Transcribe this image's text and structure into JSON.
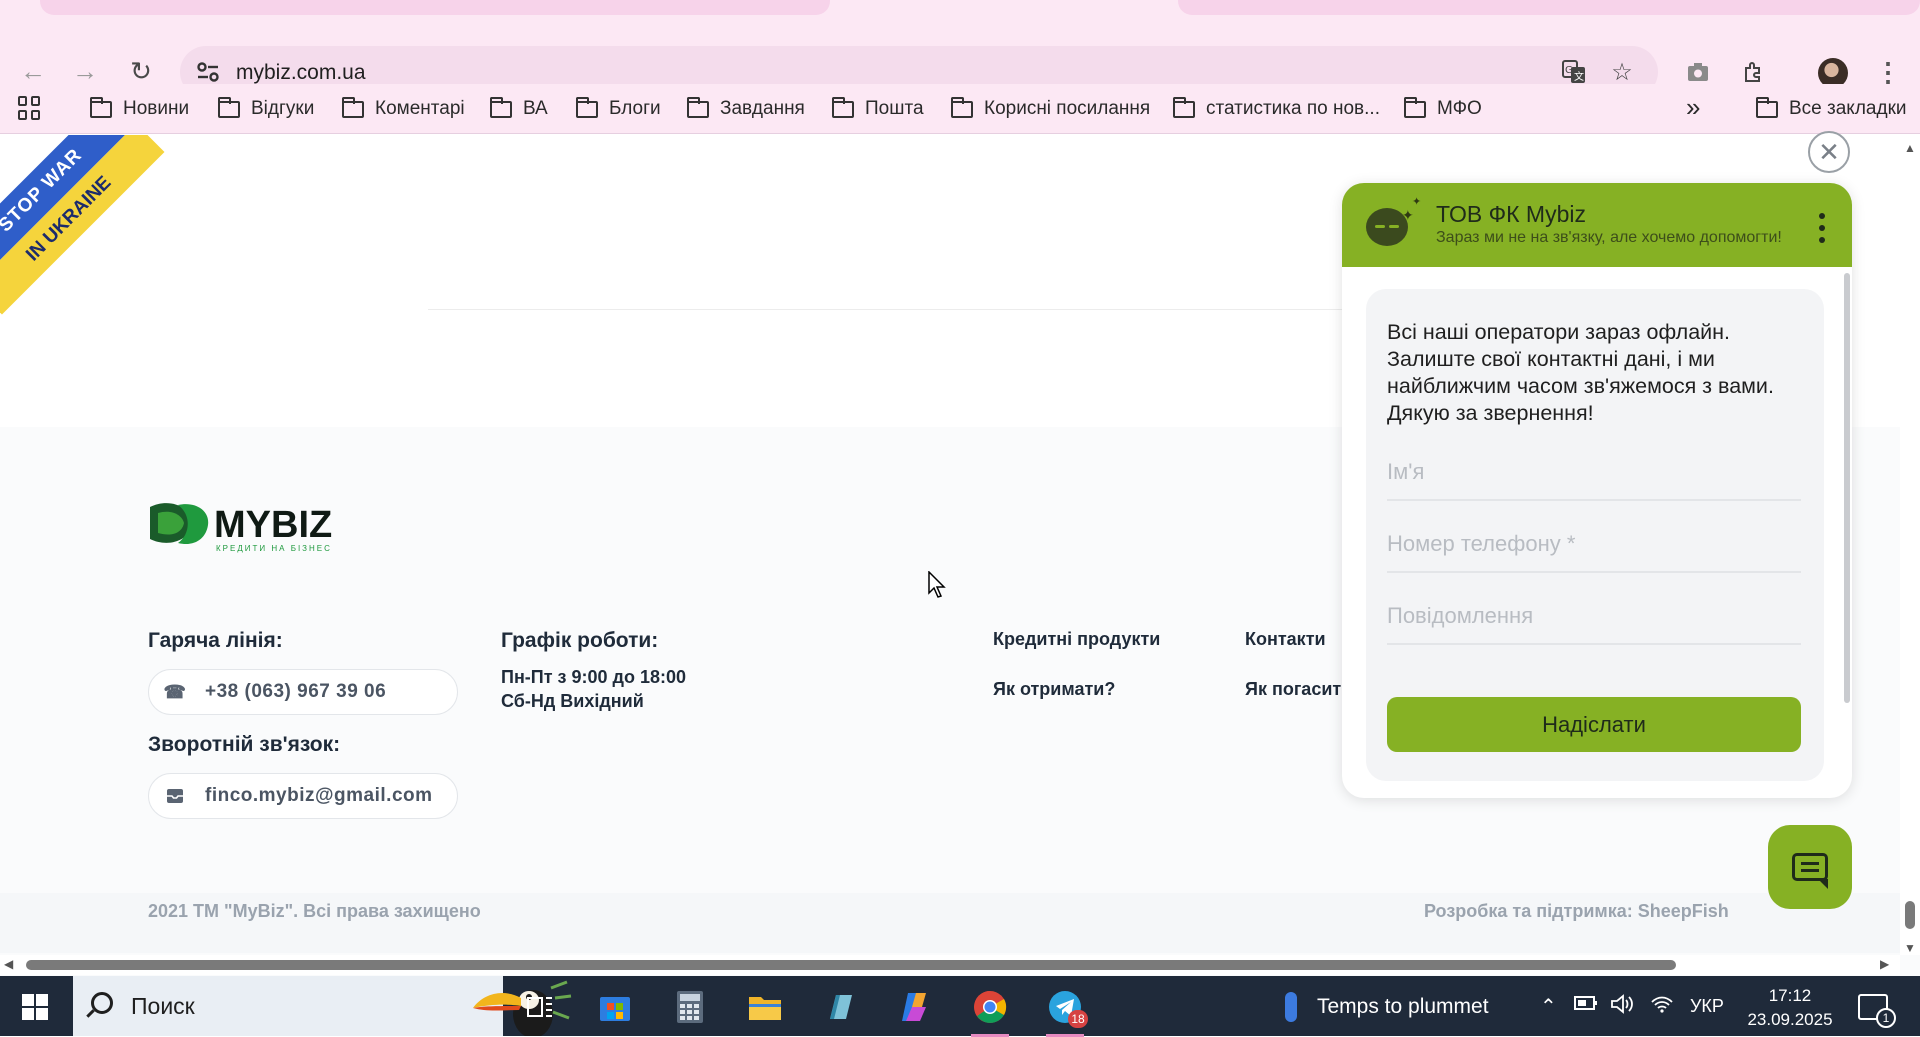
{
  "browser": {
    "url": "mybiz.com.ua",
    "bookmarks": [
      "Новини",
      "Відгуки",
      "Коментарі",
      "ВА",
      "Блоги",
      "Завдання",
      "Пошта",
      "Корисні посилання",
      "статистика по нов...",
      "МФО"
    ],
    "all_bookmarks": "Все закладки",
    "more": "»"
  },
  "banner": {
    "line1": "STOP WAR",
    "line2": "IN UKRAINE"
  },
  "footer": {
    "logo_text": "MYBIZ",
    "logo_tagline": "КРЕДИТИ НА БІЗНЕС",
    "hotline_title": "Гаряча лінія:",
    "phone": "+38 (063) 967 39 06",
    "feedback_title": "Зворотній зв'язок:",
    "email": "finco.mybiz@gmail.com",
    "schedule_title": "Графік роботи:",
    "schedule_weekdays": "Пн-Пт з 9:00 до 18:00",
    "schedule_weekend": "Сб-Нд Вихідний",
    "links": [
      "Кредитні продукти",
      "Контакти",
      "Як отримати?",
      "Як погасит"
    ],
    "copyright": "2021 ТМ \"MyBiz\". Всі права захищено",
    "developer": "Розробка та підтримка: SheepFish"
  },
  "chat": {
    "title": "ТОВ ФК Mybiz",
    "subtitle": "Зараз ми не на зв'язку, але хочемо допомогти!",
    "message": "Всі наші оператори зараз офлайн. Залиште свої контактні дані, і ми найближчим часом зв'яжемося з вами. Дякую за звернення!",
    "name_placeholder": "Ім'я",
    "phone_placeholder": "Номер телефону *",
    "message_placeholder": "Повідомлення",
    "send_label": "Надіслати",
    "accent_color": "#86b124"
  },
  "taskbar": {
    "search_label": "Поиск",
    "weather": "Temps to plummet",
    "language": "УКР",
    "time": "17:12",
    "date": "23.09.2025",
    "telegram_badge": "18",
    "notifications": "1"
  }
}
